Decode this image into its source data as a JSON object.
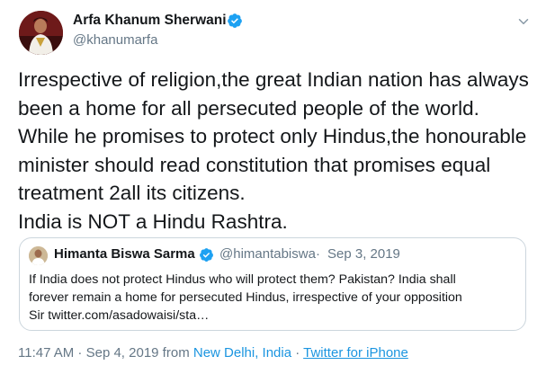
{
  "author": {
    "display_name": "Arfa Khanum Sherwani",
    "handle": "@khanumarfa"
  },
  "tweet": {
    "lines": [
      "Irrespective of religion,the great Indian nation has always",
      "been a home for all persecuted people of the world.",
      "While he promises to protect only Hindus,the honourable",
      "minister should read constitution that promises equal",
      "treatment 2all its citizens.",
      "India is NOT a Hindu Rashtra."
    ]
  },
  "quoted_tweet": {
    "display_name": "Himanta Biswa Sarma",
    "handle": "@himantabiswa",
    "separator": "·",
    "date": "Sep 3, 2019",
    "lines": [
      "If India does not protect Hindus who will protect them? Pakistan? India shall",
      "forever remain a home for persecuted Hindus, irrespective of your opposition",
      "Sir twitter.com/asadowaisi/sta…"
    ]
  },
  "meta": {
    "time": "11:47 AM",
    "sep1": " · ",
    "date": "Sep 4, 2019",
    "from_label": " from ",
    "location": "New Delhi, India",
    "sep2": " · ",
    "source": "Twitter for iPhone"
  },
  "icons": {
    "verified": "verified-badge-icon",
    "menu": "chevron-down-icon"
  },
  "colors": {
    "link": "#1b95e0",
    "verified": "#1da1f2",
    "secondary_text": "#657786",
    "border": "#ccd6dd"
  }
}
